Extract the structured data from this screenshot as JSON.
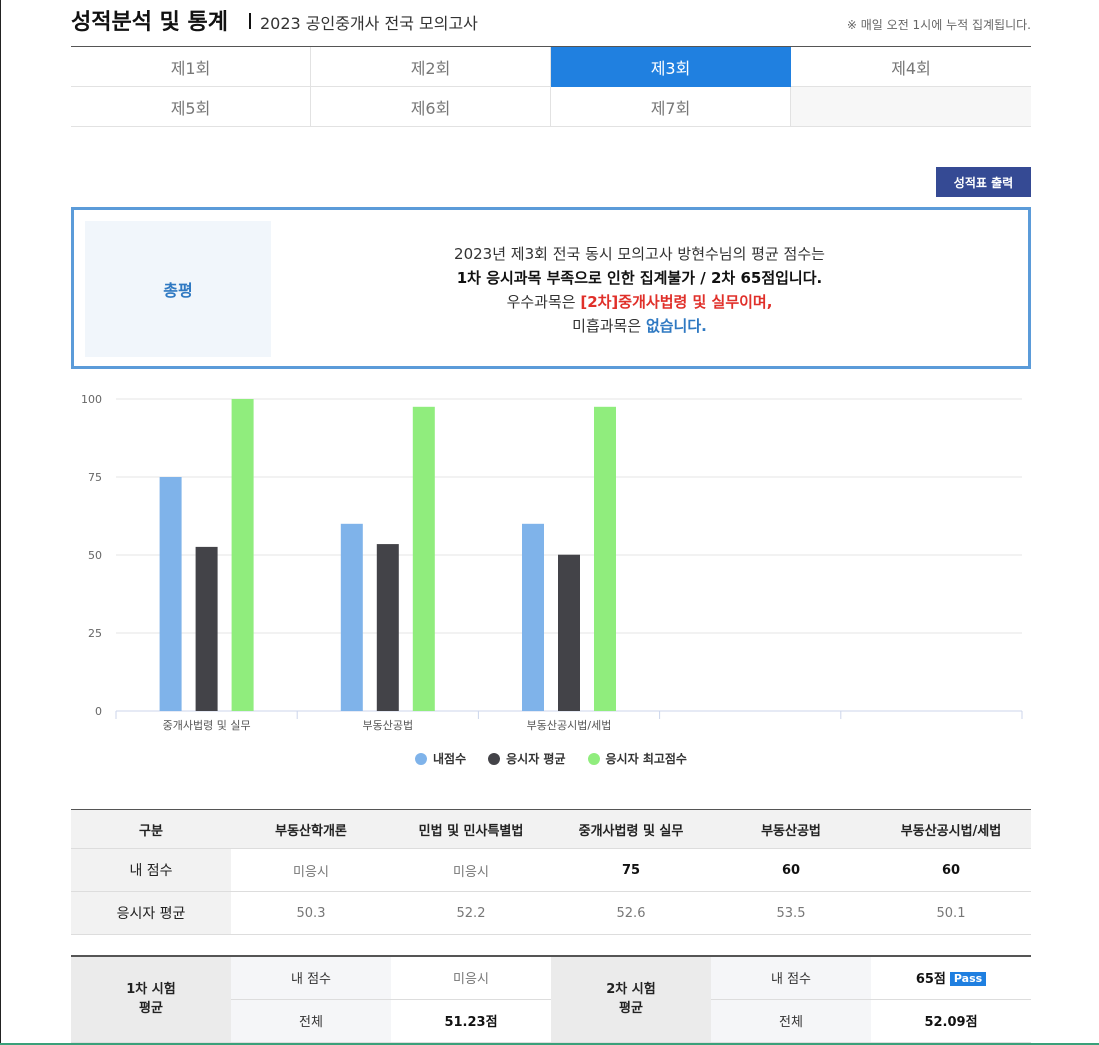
{
  "header": {
    "title": "성적분석 및 통계",
    "subtitle": "2023 공인중개사 전국 모의고사",
    "notice": "※ 매일 오전 1시에 누적 집계됩니다."
  },
  "tabs": {
    "row1": [
      {
        "label": "제1회",
        "active": false
      },
      {
        "label": "제2회",
        "active": false
      },
      {
        "label": "제3회",
        "active": true
      },
      {
        "label": "제4회",
        "active": false
      }
    ],
    "row2": [
      {
        "label": "제5회",
        "active": false
      },
      {
        "label": "제6회",
        "active": false
      },
      {
        "label": "제7회",
        "active": false
      }
    ]
  },
  "print_button": {
    "label": "성적표 출력"
  },
  "summary": {
    "label": "총평",
    "line1": "2023년 제3회 전국 동시 모의고사 방현수님의 평균 점수는",
    "line2": "1차 응시과목 부족으로 인한 집계불가 / 2차 65점입니다.",
    "line3_prefix": "우수과목은 ",
    "line3_highlight": "[2차]중개사법령 및 실무이며,",
    "line4_prefix": "미흡과목은 ",
    "line4_highlight": "없습니다."
  },
  "colors": {
    "accent": "#2080e0",
    "button": "#354a94",
    "summary_border": "#5b9bd9",
    "series_my": "#7fb3ea",
    "series_avg": "#434348",
    "series_max": "#90ed7d",
    "red": "#e0302a"
  },
  "chart_data": {
    "type": "bar",
    "categories": [
      "중개사법령 및 실무",
      "부동산공법",
      "부동산공시법/세법",
      "",
      ""
    ],
    "series": [
      {
        "name": "내점수",
        "color": "#7fb3ea",
        "values": [
          75,
          60,
          60,
          null,
          null
        ]
      },
      {
        "name": "응시자 평균",
        "color": "#434348",
        "values": [
          52.6,
          53.5,
          50.1,
          null,
          null
        ]
      },
      {
        "name": "응시자 최고점수",
        "color": "#90ed7d",
        "values": [
          100,
          97.5,
          97.5,
          null,
          null
        ]
      }
    ],
    "ylim": [
      0,
      100
    ],
    "yticks": [
      0,
      25,
      50,
      75,
      100
    ],
    "grid": true,
    "legend": "bottom-center"
  },
  "score_table": {
    "headers": [
      "구분",
      "부동산학개론",
      "민법 및 민사특별법",
      "중개사법령 및 실무",
      "부동산공법",
      "부동산공시법/세법"
    ],
    "rows": [
      {
        "label": "내 점수",
        "cells": [
          "미응시",
          "미응시",
          "75",
          "60",
          "60"
        ],
        "strong": [
          false,
          false,
          true,
          true,
          true
        ]
      },
      {
        "label": "응시자 평균",
        "cells": [
          "50.3",
          "52.2",
          "52.6",
          "53.5",
          "50.1"
        ],
        "strong": [
          false,
          false,
          false,
          false,
          false
        ]
      }
    ]
  },
  "avg_table": {
    "first": {
      "group_line1": "1차 시험",
      "group_line2": "평균",
      "my_label": "내 점수",
      "my_value": "미응시",
      "all_label": "전체",
      "all_value": "51.23점"
    },
    "second": {
      "group_line1": "2차 시험",
      "group_line2": "평균",
      "my_label": "내 점수",
      "my_value": "65점",
      "badge": "Pass",
      "all_label": "전체",
      "all_value": "52.09점"
    }
  }
}
